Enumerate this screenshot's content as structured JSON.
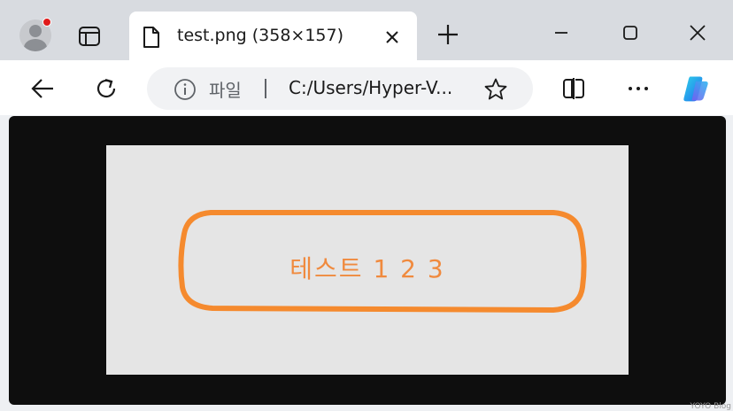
{
  "tab": {
    "title": "test.png (358×157)",
    "icon": "file-icon"
  },
  "address": {
    "site_label": "파일",
    "url": "C:/Users/Hyper-V..."
  },
  "content": {
    "image_text": "테스트 1 2 3",
    "outline_color": "#f58a2e",
    "text_color": "#f08a3e",
    "background_color": "#e5e5e5"
  },
  "watermark": "YOYO Blog",
  "colors": {
    "tabstrip": "#d8dbe0",
    "viewport": "#0e0e0e",
    "profile_dot": "#e01a1a"
  }
}
